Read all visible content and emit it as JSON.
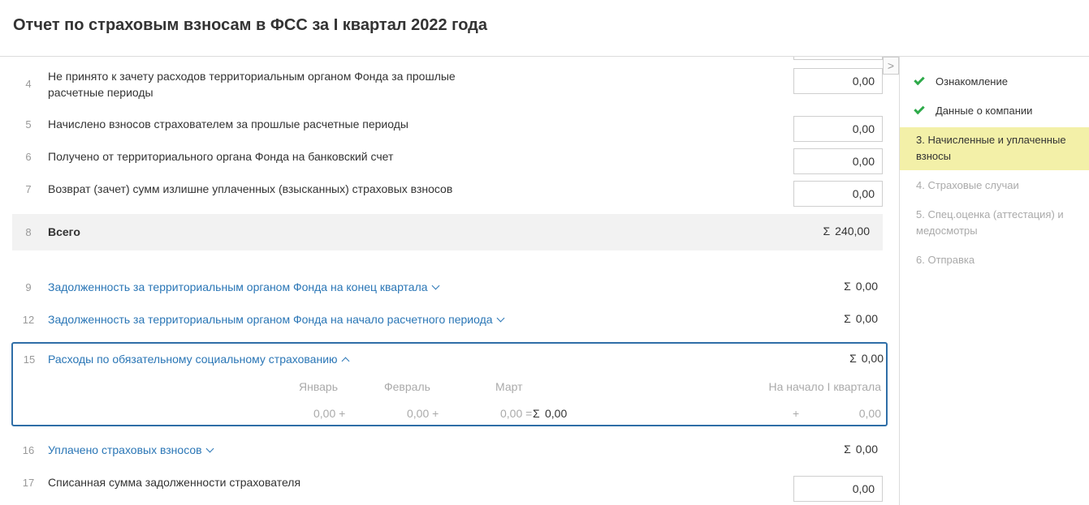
{
  "header": {
    "title": "Отчет по страховым взносам в ФСС за I квартал 2022 года"
  },
  "rows": {
    "r4": {
      "num": "4",
      "label_line1": "Не принято к зачету расходов территориальным органом Фонда за прошлые",
      "label_line2": "расчетные периоды",
      "value": "0,00"
    },
    "r5": {
      "num": "5",
      "label": "Начислено взносов страхователем за прошлые расчетные периоды",
      "value": "0,00"
    },
    "r6": {
      "num": "6",
      "label": "Получено от территориального органа Фонда на банковский счет",
      "value": "0,00"
    },
    "r7": {
      "num": "7",
      "label": "Возврат (зачет) сумм излишне уплаченных (взысканных) страховых взносов",
      "value": "0,00"
    },
    "r8": {
      "num": "8",
      "label": "Всего",
      "sigma": "Σ",
      "value": "240,00"
    },
    "r9": {
      "num": "9",
      "label": "Задолженность за территориальным органом Фонда на конец квартала",
      "sigma": "Σ",
      "value": "0,00"
    },
    "r12": {
      "num": "12",
      "label": "Задолженность за территориальным органом Фонда на начало расчетного периода",
      "sigma": "Σ",
      "value": "0,00"
    },
    "r15": {
      "num": "15",
      "label": "Расходы по обязательному социальному страхованию",
      "sigma": "Σ",
      "value": "0,00",
      "col_jan": "Январь",
      "col_feb": "Февраль",
      "col_mar": "Март",
      "col_start": "На начало I квартала",
      "jan_value": "0,00 +",
      "feb_value": "0,00 +",
      "mar_value": "0,00 =",
      "sum_sigma": "Σ",
      "sum_value": "0,00",
      "plus": "+",
      "start_value": "0,00"
    },
    "r16": {
      "num": "16",
      "label": "Уплачено страховых взносов",
      "sigma": "Σ",
      "value": "0,00"
    },
    "r17": {
      "num": "17",
      "label": "Списанная сумма задолженности страхователя",
      "value": "0,00"
    }
  },
  "sidebar": {
    "collapse_glyph": ">",
    "steps": [
      {
        "label": "Ознакомление",
        "state": "done"
      },
      {
        "label": "Данные о компании",
        "state": "done"
      },
      {
        "label": "3.  Начисленные и уплаченные взносы",
        "state": "active"
      },
      {
        "label": "4.  Страховые случаи",
        "state": "pending"
      },
      {
        "label": "5.  Спец.оценка (аттестация) и медосмотры",
        "state": "pending"
      },
      {
        "label": "6.  Отправка",
        "state": "pending"
      }
    ]
  },
  "colors": {
    "accent": "#2f6ea7",
    "link": "#2a76b6",
    "check": "#2eaa4a",
    "active_step": "#f3f0a8"
  }
}
